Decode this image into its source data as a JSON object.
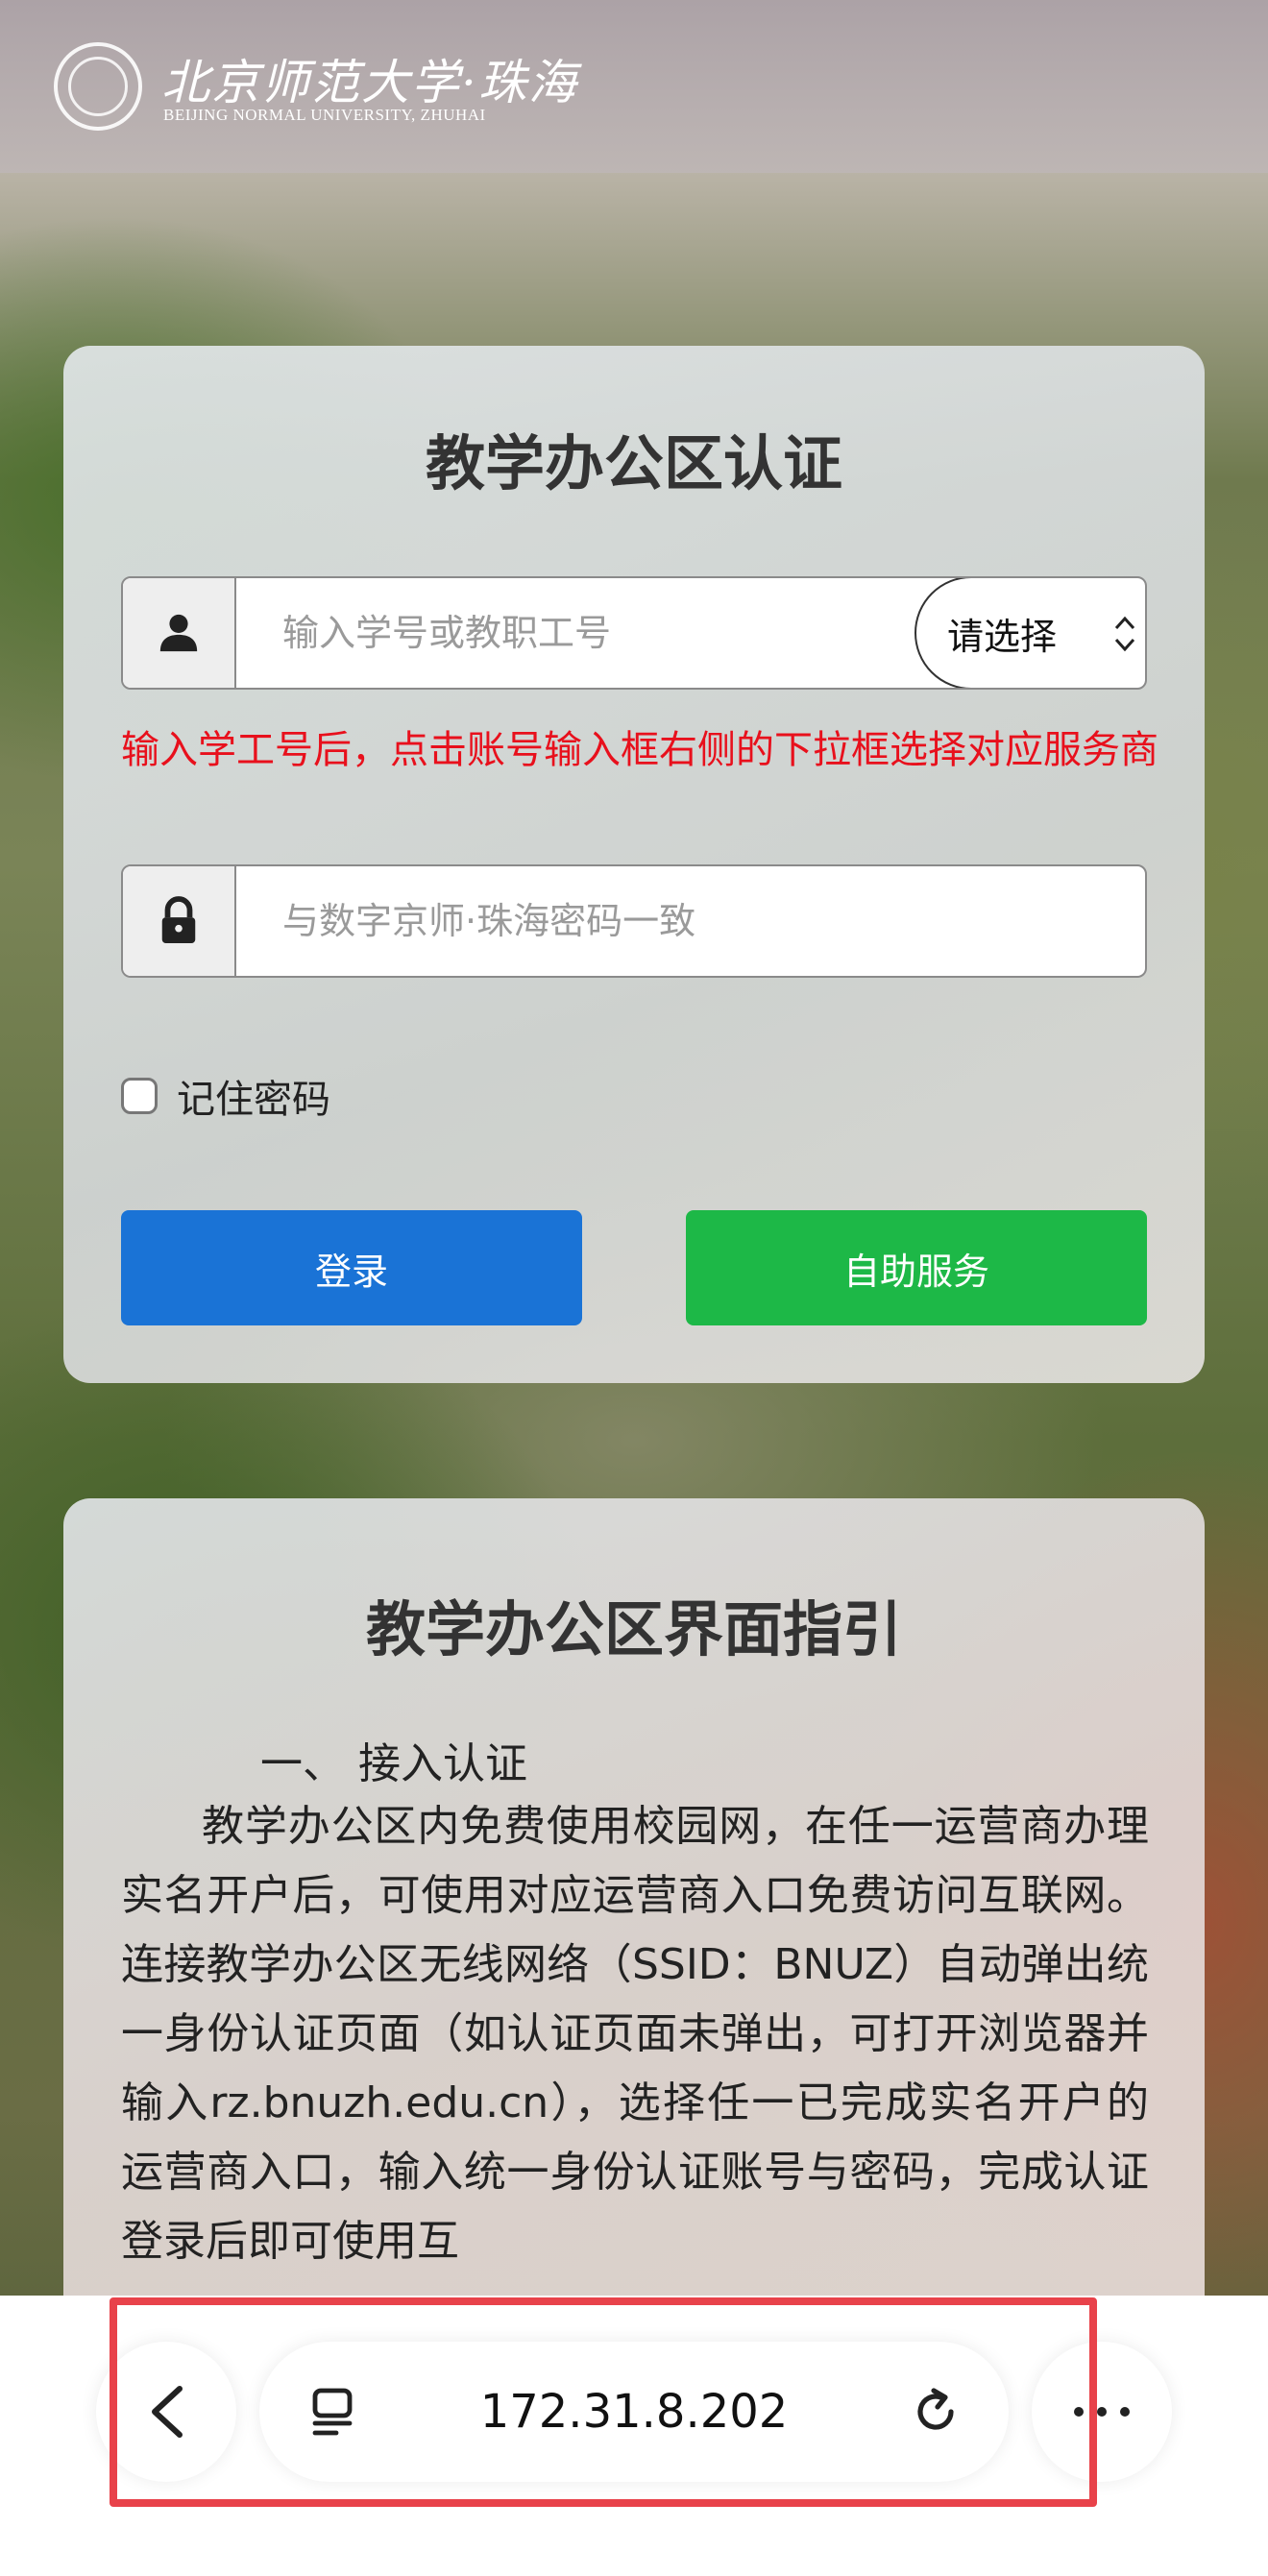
{
  "header": {
    "logo_cn": "北京师范大学·珠海",
    "logo_en": "BEIJING NORMAL UNIVERSITY, ZHUHAI"
  },
  "login": {
    "title": "教学办公区认证",
    "account_placeholder": "输入学号或教职工号",
    "provider_select": "请选择",
    "hint": "输入学工号后，点击账号输入框右侧的下拉框选择对应服务商",
    "password_placeholder": "与数字京师·珠海密码一致",
    "remember_label": "记住密码",
    "login_button": "登录",
    "self_service_button": "自助服务",
    "colors": {
      "login_button": "#1a73d6",
      "self_service_button": "#1db847",
      "hint": "#e8101c"
    }
  },
  "guide": {
    "title": "教学办公区界面指引",
    "heading": "一、 接入认证",
    "body": "教学办公区内免费使用校园网，在任一运营商办理实名开户后，可使用对应运营商入口免费访问互联网。连接教学办公区无线网络（SSID：BNUZ）自动弹出统一身份认证页面（如认证页面未弹出，可打开浏览器并输入rz.bnuzh.edu.cn），选择任一已完成实名开户的运营商入口，输入统一身份认证账号与密码，完成认证登录后即可使用互"
  },
  "browser": {
    "url": "172.31.8.202",
    "icons": {
      "back": "chevron-left-icon",
      "tabs": "tabs-icon",
      "reload": "reload-icon",
      "more": "more-icon"
    }
  }
}
